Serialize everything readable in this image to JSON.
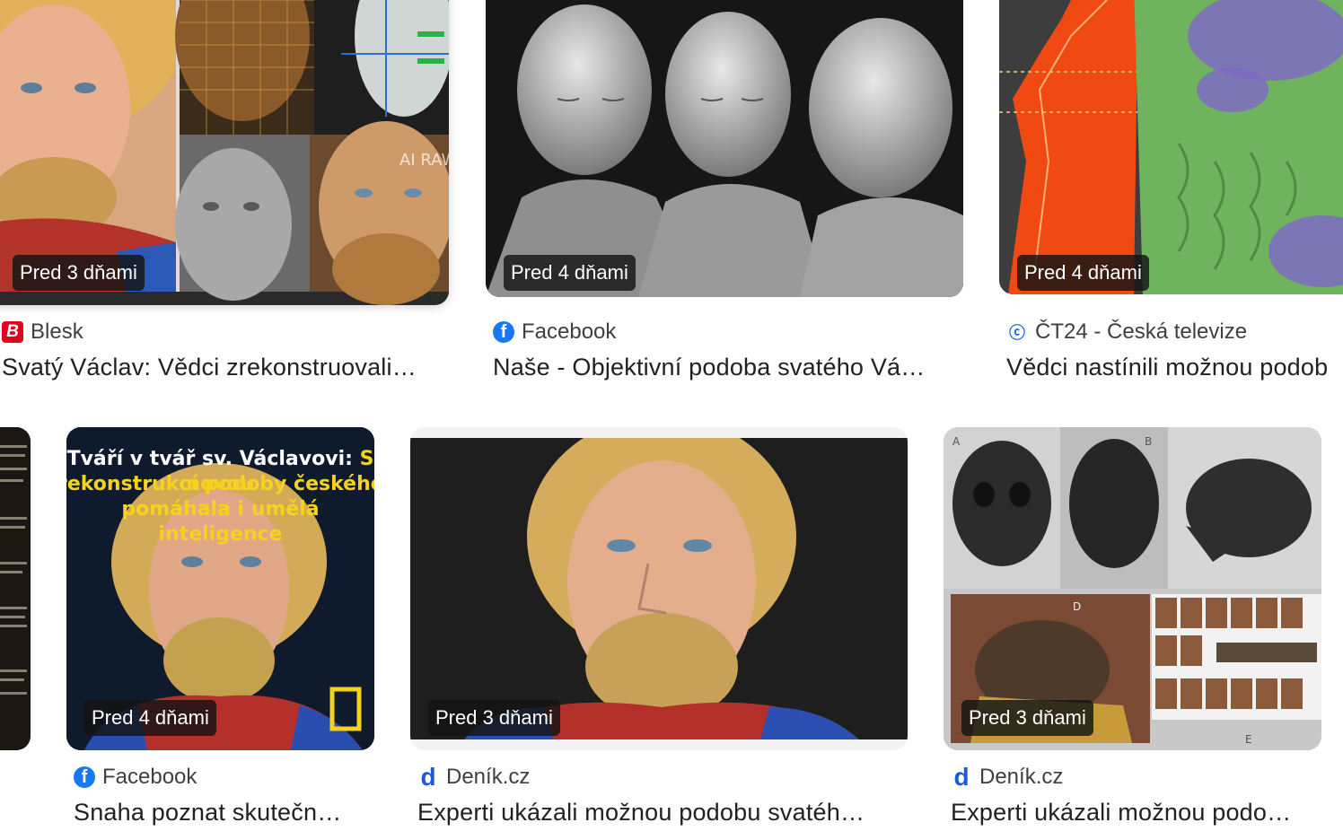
{
  "results": [
    {
      "time": "Pred 3 dňami",
      "source": "Blesk",
      "source_icon": "blesk-icon",
      "title": "Svatý Václav: Vědci zrekonstruovali…"
    },
    {
      "time": "Pred 4 dňami",
      "source": "Facebook",
      "source_icon": "facebook-icon",
      "title": "Naše - Objektivní podoba svatého Vá…"
    },
    {
      "time": "Pred 4 dňami",
      "source": "ČT24 - Česká televize",
      "source_icon": "ct24-icon",
      "title": "Vědci nastínili možnou podob"
    },
    {
      "time": "Pred 4 dňami",
      "source": "Facebook",
      "source_icon": "facebook-icon",
      "title": "Snaha poznat skutečn…"
    },
    {
      "time": "Pred 3 dňami",
      "source": "Deník.cz",
      "source_icon": "denik-icon",
      "title": "Experti ukázali možnou podobu svatéh…"
    },
    {
      "time": "Pred 3 dňami",
      "source": "Deník.cz",
      "source_icon": "denik-icon",
      "title": "Experti ukázali možnou podo…"
    }
  ],
  "overlay_text": {
    "line1a": "Tváří v tvář sv. Václavovi: ",
    "line1b": "S novou",
    "line2": "rekonstrukcí podoby českého patrona",
    "line3": "pomáhala i umělá inteligence",
    "ai_raw": "AI RAW",
    "labels": [
      "A",
      "B",
      "D",
      "E"
    ]
  },
  "colors": {
    "badge_bg": "#141414",
    "title": "#202124",
    "source": "#3c4043",
    "facebook": "#1877f2",
    "blesk": "#e2001a",
    "overlay_yellow": "#f4d21f"
  }
}
